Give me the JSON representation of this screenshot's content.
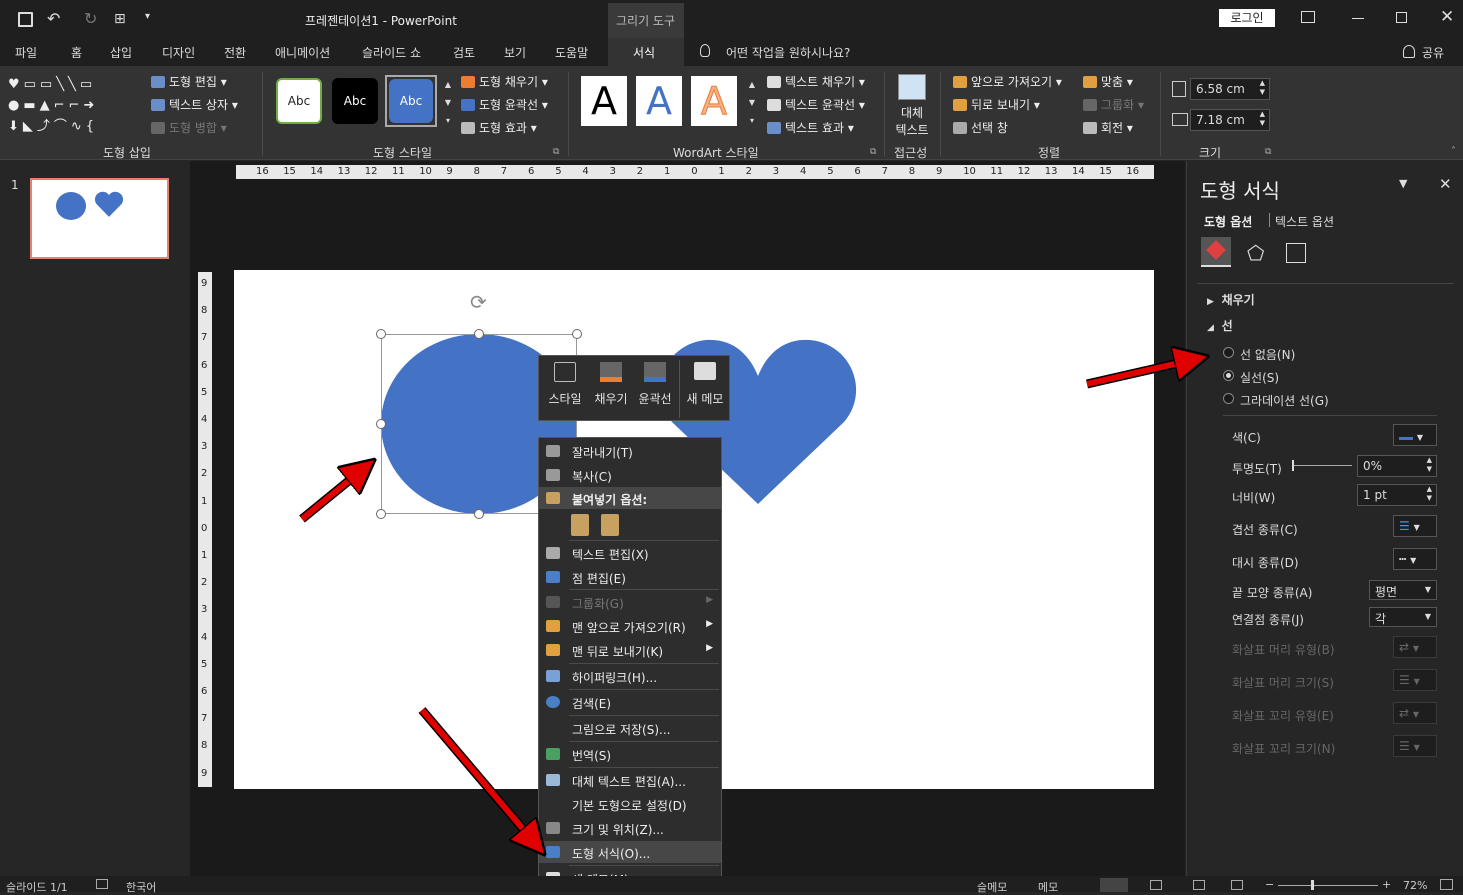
{
  "titlebar": {
    "doc_title": "프레젠테이션1 - PowerPoint",
    "context_tab": "그리기 도구",
    "login": "로그인"
  },
  "tabs": [
    "파일",
    "홈",
    "삽입",
    "디자인",
    "전환",
    "애니메이션",
    "슬라이드 쇼",
    "검토",
    "보기",
    "도움말",
    "서식"
  ],
  "tell_me": "어떤 작업을 원하시나요?",
  "share": "공유",
  "ribbon": {
    "insert_shapes": {
      "edit_shape": "도형 편집",
      "text_box": "텍스트 상자",
      "merge_shapes": "도형 병합",
      "label": "도형 삽입"
    },
    "shape_styles": {
      "style_text": "Abc",
      "fill": "도형 채우기",
      "outline": "도형 윤곽선",
      "effects": "도형 효과",
      "label": "도형 스타일"
    },
    "wordart": {
      "letter": "A",
      "text_fill": "텍스트 채우기",
      "text_outline": "텍스트 윤곽선",
      "text_effects": "텍스트 효과",
      "label": "WordArt 스타일"
    },
    "accessibility": {
      "alt_text_1": "대체",
      "alt_text_2": "텍스트",
      "label": "접근성"
    },
    "arrange": {
      "bring_forward": "앞으로 가져오기",
      "send_backward": "뒤로 보내기",
      "selection_pane": "선택 창",
      "align": "맞춤",
      "group": "그룹화",
      "rotate": "회전",
      "label": "정렬"
    },
    "size": {
      "height": "6.58 cm",
      "width": "7.18 cm",
      "label": "크기"
    }
  },
  "thumbnail": {
    "number": "1"
  },
  "ruler": {
    "h_ticks": [
      "16",
      "15",
      "14",
      "13",
      "12",
      "11",
      "10",
      "9",
      "8",
      "7",
      "6",
      "5",
      "4",
      "3",
      "2",
      "1",
      "0",
      "1",
      "2",
      "3",
      "4",
      "5",
      "6",
      "7",
      "8",
      "9",
      "10",
      "11",
      "12",
      "13",
      "14",
      "15",
      "16"
    ],
    "v_ticks": [
      "9",
      "8",
      "7",
      "6",
      "5",
      "4",
      "3",
      "2",
      "1",
      "0",
      "1",
      "2",
      "3",
      "4",
      "5",
      "6",
      "7",
      "8",
      "9"
    ]
  },
  "mini_toolbar": {
    "style": "스타일",
    "fill": "채우기",
    "outline": "윤곽선",
    "new_comment": "새 메모"
  },
  "context_menu": {
    "cut": "잘라내기(T)",
    "copy": "복사(C)",
    "paste_options": "붙여넣기 옵션:",
    "edit_text": "텍스트 편집(X)",
    "edit_points": "점 편집(E)",
    "group": "그룹화(G)",
    "bring_to_front": "맨 앞으로 가져오기(R)",
    "send_to_back": "맨 뒤로 보내기(K)",
    "hyperlink": "하이퍼링크(H)...",
    "search": "검색(E)",
    "save_as_picture": "그림으로 저장(S)...",
    "translate": "번역(S)",
    "edit_alt_text": "대체 텍스트 편집(A)...",
    "set_default_shape": "기본 도형으로 설정(D)",
    "size_position": "크기 및 위치(Z)...",
    "format_shape": "도형 서식(O)...",
    "new_comment": "새 메모(M)"
  },
  "pane": {
    "title": "도형 서식",
    "tab_shape": "도형 옵션",
    "tab_text": "텍스트 옵션",
    "fill_section": "채우기",
    "line_section": "선",
    "no_line": "선 없음(N)",
    "solid_line": "실선(S)",
    "gradient_line": "그라데이션 선(G)",
    "color": "색(C)",
    "transparency": "투명도(T)",
    "transparency_value": "0%",
    "width": "너비(W)",
    "width_value": "1 pt",
    "compound_type": "겹선 종류(C)",
    "dash_type": "대시 종류(D)",
    "cap_type": "끝 모양 종류(A)",
    "cap_value": "평면",
    "join_type": "연결점 종류(J)",
    "join_value": "각",
    "begin_arrow_type": "화살표 머리 유형(B)",
    "begin_arrow_size": "화살표 머리 크기(S)",
    "end_arrow_type": "화살표 꼬리 유형(E)",
    "end_arrow_size": "화살표 꼬리 크기(N)"
  },
  "status": {
    "slide_count": "슬라이드 1/1",
    "language": "한국어",
    "notes": "슬메모",
    "comments": "메모",
    "zoom": "72%"
  },
  "colors": {
    "shape_fill": "#4472c4",
    "arrow": "#e00000",
    "thumb_border": "#e8806b"
  }
}
